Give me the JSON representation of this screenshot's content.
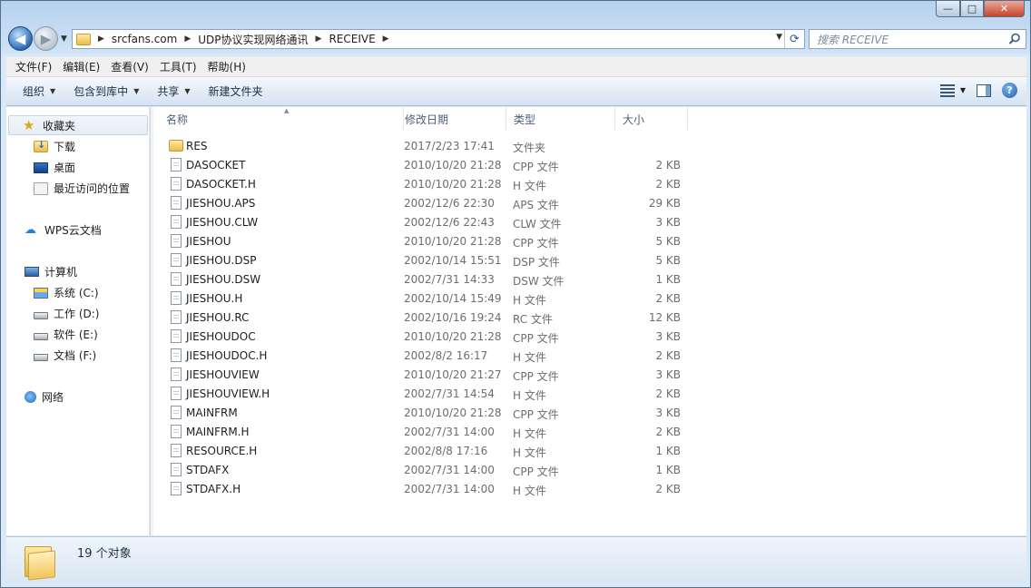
{
  "window": {
    "controls": {
      "minimize": "—",
      "maximize": "□",
      "close": "✕"
    }
  },
  "nav": {
    "back_icon": "◀",
    "forward_icon": "▶",
    "breadcrumbs": [
      "srcfans.com",
      "UDP协议实现网络通讯",
      "RECEIVE"
    ],
    "search_placeholder": "搜索 RECEIVE"
  },
  "menubar": [
    "文件(F)",
    "编辑(E)",
    "查看(V)",
    "工具(T)",
    "帮助(H)"
  ],
  "toolbar": {
    "organize": "组织",
    "include_in_library": "包含到库中",
    "share": "共享",
    "new_folder": "新建文件夹",
    "help": "?"
  },
  "sidebar": {
    "favorites": "收藏夹",
    "downloads": "下载",
    "desktop": "桌面",
    "recent": "最近访问的位置",
    "wps_cloud": "WPS云文档",
    "computer": "计算机",
    "drives": [
      "系统 (C:)",
      "工作 (D:)",
      "软件 (E:)",
      "文档 (F:)"
    ],
    "network": "网络"
  },
  "columns": {
    "name": "名称",
    "date": "修改日期",
    "type": "类型",
    "size": "大小"
  },
  "files": [
    {
      "name": "RES",
      "date": "2017/2/23 17:41",
      "type": "文件夹",
      "size": "",
      "kind": "folder"
    },
    {
      "name": "DASOCKET",
      "date": "2010/10/20 21:28",
      "type": "CPP 文件",
      "size": "2 KB",
      "kind": "file"
    },
    {
      "name": "DASOCKET.H",
      "date": "2010/10/20 21:28",
      "type": "H 文件",
      "size": "2 KB",
      "kind": "file"
    },
    {
      "name": "JIESHOU.APS",
      "date": "2002/12/6 22:30",
      "type": "APS 文件",
      "size": "29 KB",
      "kind": "file"
    },
    {
      "name": "JIESHOU.CLW",
      "date": "2002/12/6 22:43",
      "type": "CLW 文件",
      "size": "3 KB",
      "kind": "file"
    },
    {
      "name": "JIESHOU",
      "date": "2010/10/20 21:28",
      "type": "CPP 文件",
      "size": "5 KB",
      "kind": "file"
    },
    {
      "name": "JIESHOU.DSP",
      "date": "2002/10/14 15:51",
      "type": "DSP 文件",
      "size": "5 KB",
      "kind": "file"
    },
    {
      "name": "JIESHOU.DSW",
      "date": "2002/7/31 14:33",
      "type": "DSW 文件",
      "size": "1 KB",
      "kind": "file"
    },
    {
      "name": "JIESHOU.H",
      "date": "2002/10/14 15:49",
      "type": "H 文件",
      "size": "2 KB",
      "kind": "file"
    },
    {
      "name": "JIESHOU.RC",
      "date": "2002/10/16 19:24",
      "type": "RC 文件",
      "size": "12 KB",
      "kind": "file"
    },
    {
      "name": "JIESHOUDOC",
      "date": "2010/10/20 21:28",
      "type": "CPP 文件",
      "size": "3 KB",
      "kind": "file"
    },
    {
      "name": "JIESHOUDOC.H",
      "date": "2002/8/2 16:17",
      "type": "H 文件",
      "size": "2 KB",
      "kind": "file"
    },
    {
      "name": "JIESHOUVIEW",
      "date": "2010/10/20 21:27",
      "type": "CPP 文件",
      "size": "3 KB",
      "kind": "file"
    },
    {
      "name": "JIESHOUVIEW.H",
      "date": "2002/7/31 14:54",
      "type": "H 文件",
      "size": "2 KB",
      "kind": "file"
    },
    {
      "name": "MAINFRM",
      "date": "2010/10/20 21:28",
      "type": "CPP 文件",
      "size": "3 KB",
      "kind": "file"
    },
    {
      "name": "MAINFRM.H",
      "date": "2002/7/31 14:00",
      "type": "H 文件",
      "size": "2 KB",
      "kind": "file"
    },
    {
      "name": "RESOURCE.H",
      "date": "2002/8/8 17:16",
      "type": "H 文件",
      "size": "1 KB",
      "kind": "file"
    },
    {
      "name": "STDAFX",
      "date": "2002/7/31 14:00",
      "type": "CPP 文件",
      "size": "1 KB",
      "kind": "file"
    },
    {
      "name": "STDAFX.H",
      "date": "2002/7/31 14:00",
      "type": "H 文件",
      "size": "2 KB",
      "kind": "file"
    }
  ],
  "status": {
    "count_text": "19 个对象"
  }
}
